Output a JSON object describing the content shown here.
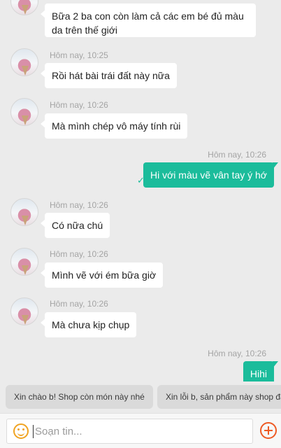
{
  "messages": [
    {
      "time": "",
      "text": "Bữa 2 ba con còn làm cả các em bé đủ màu da trên thế giới"
    },
    {
      "time": "Hôm nay, 10:25",
      "text": "Rồi hát bài trái đất này nữa"
    },
    {
      "time": "Hôm nay, 10:26",
      "text": "Mà mình chép vô máy tính rùi"
    },
    {
      "time": "Hôm nay, 10:26",
      "text": "Hi với màu vẽ vân tay ý hớ",
      "check": "✓"
    },
    {
      "time": "Hôm nay, 10:26",
      "text": "Có nữa chú"
    },
    {
      "time": "Hôm nay, 10:26",
      "text": "Mình vẽ với ém bữa giờ"
    },
    {
      "time": "Hôm nay, 10:26",
      "text": "Mà chưa kịp chụp"
    },
    {
      "time": "Hôm nay, 10:26",
      "text": "Hihi"
    }
  ],
  "quick_replies": [
    "Xin chào b! Shop còn món này nhé",
    "Xin lỗi b, sản phẩm này shop đã hết hàng"
  ],
  "composer": {
    "placeholder": "Soạn tin...",
    "value": ""
  },
  "icons": {
    "emoji": "smiley-face-icon",
    "add": "plus-circle-icon",
    "sent": "check-icon"
  },
  "colors": {
    "outgoing_bubble": "#1bbc9b",
    "incoming_bubble": "#ffffff",
    "background": "#ebebeb",
    "add_button": "#ee5a24",
    "emoji_icon": "#f0a321"
  }
}
